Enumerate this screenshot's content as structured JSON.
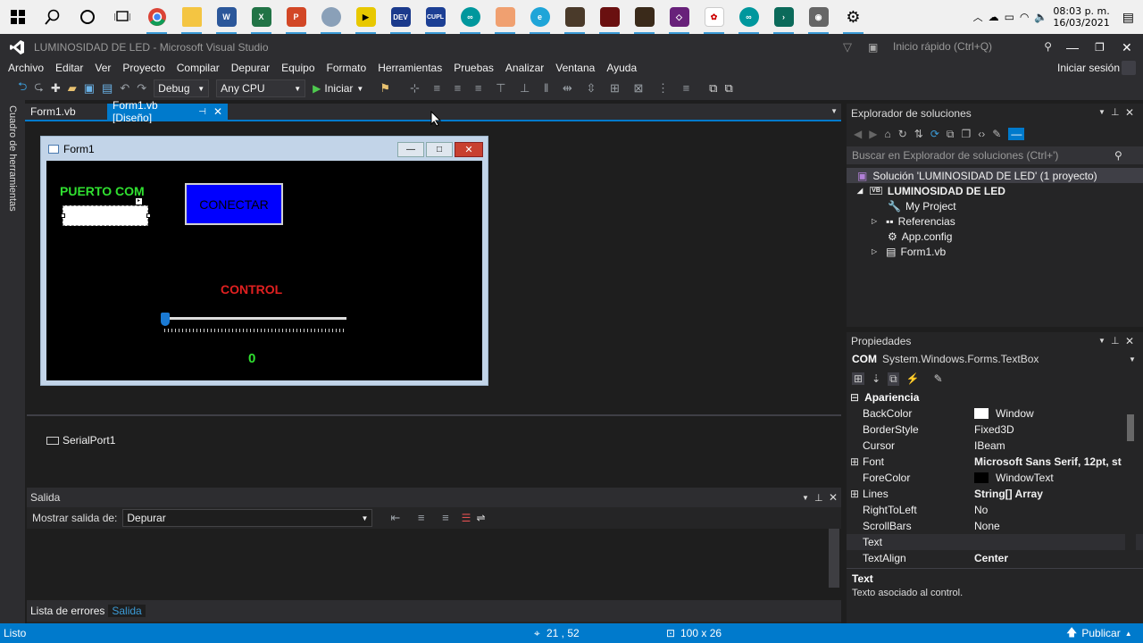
{
  "taskbar": {
    "icons": [
      "windows-start",
      "search",
      "cortana",
      "task-view",
      "chrome",
      "file-explorer",
      "word",
      "excel",
      "powerpoint",
      "bug-app",
      "labview",
      "dev-cpp",
      "cupl",
      "arduino",
      "app-orange",
      "edge",
      "app-dark",
      "app-red",
      "app-dark2",
      "visual-studio",
      "app-logo",
      "arduino2",
      "terminal",
      "camera",
      "settings"
    ],
    "clock_time": "08:03 p. m.",
    "clock_date": "16/03/2021"
  },
  "window": {
    "title": "LUMINOSIDAD DE LED - Microsoft Visual Studio",
    "quick_launch_placeholder": "Inicio rápido (Ctrl+Q)",
    "sign_in": "Iniciar sesión"
  },
  "menu": [
    "Archivo",
    "Editar",
    "Ver",
    "Proyecto",
    "Compilar",
    "Depurar",
    "Equipo",
    "Formato",
    "Herramientas",
    "Pruebas",
    "Analizar",
    "Ventana",
    "Ayuda"
  ],
  "toolbar": {
    "config": "Debug",
    "platform": "Any CPU",
    "start": "Iniciar"
  },
  "left_strip": {
    "label": "Cuadro de herramientas"
  },
  "tabs": [
    {
      "label": "Form1.vb"
    },
    {
      "label": "Form1.vb [Diseño]"
    }
  ],
  "form": {
    "title": "Form1",
    "puerto_label": "PUERTO COM",
    "connect_button": "CONECTAR",
    "control_label": "CONTROL",
    "value_label": "0",
    "slider_value": 0
  },
  "component_tray": {
    "item": "SerialPort1"
  },
  "output": {
    "title": "Salida",
    "show_from_label": "Mostrar salida de:",
    "show_from_value": "Depurar",
    "bottom_tabs": [
      "Lista de errores",
      "Salida"
    ]
  },
  "solution_explorer": {
    "title": "Explorador de soluciones",
    "search_placeholder": "Buscar en Explorador de soluciones (Ctrl+')",
    "items": [
      {
        "label": "Solución 'LUMINOSIDAD DE LED'  (1 proyecto)"
      },
      {
        "label": "LUMINOSIDAD DE LED"
      },
      {
        "label": "My Project"
      },
      {
        "label": "Referencias"
      },
      {
        "label": "App.config"
      },
      {
        "label": "Form1.vb"
      }
    ]
  },
  "properties": {
    "title": "Propiedades",
    "object_name": "COM",
    "object_type": "System.Windows.Forms.TextBox",
    "category": "Apariencia",
    "rows": [
      {
        "name": "BackColor",
        "value": "Window"
      },
      {
        "name": "BorderStyle",
        "value": "Fixed3D"
      },
      {
        "name": "Cursor",
        "value": "IBeam"
      },
      {
        "name": "Font",
        "value": "Microsoft Sans Serif, 12pt, st"
      },
      {
        "name": "ForeColor",
        "value": "WindowText"
      },
      {
        "name": "Lines",
        "value": "String[] Array"
      },
      {
        "name": "RightToLeft",
        "value": "No"
      },
      {
        "name": "ScrollBars",
        "value": "None"
      },
      {
        "name": "Text",
        "value": ""
      },
      {
        "name": "TextAlign",
        "value": "Center"
      }
    ],
    "desc_title": "Text",
    "desc_text": "Texto asociado al control."
  },
  "status": {
    "ready": "Listo",
    "position": "21 , 52",
    "size": "100 x 26",
    "publish": "Publicar"
  }
}
